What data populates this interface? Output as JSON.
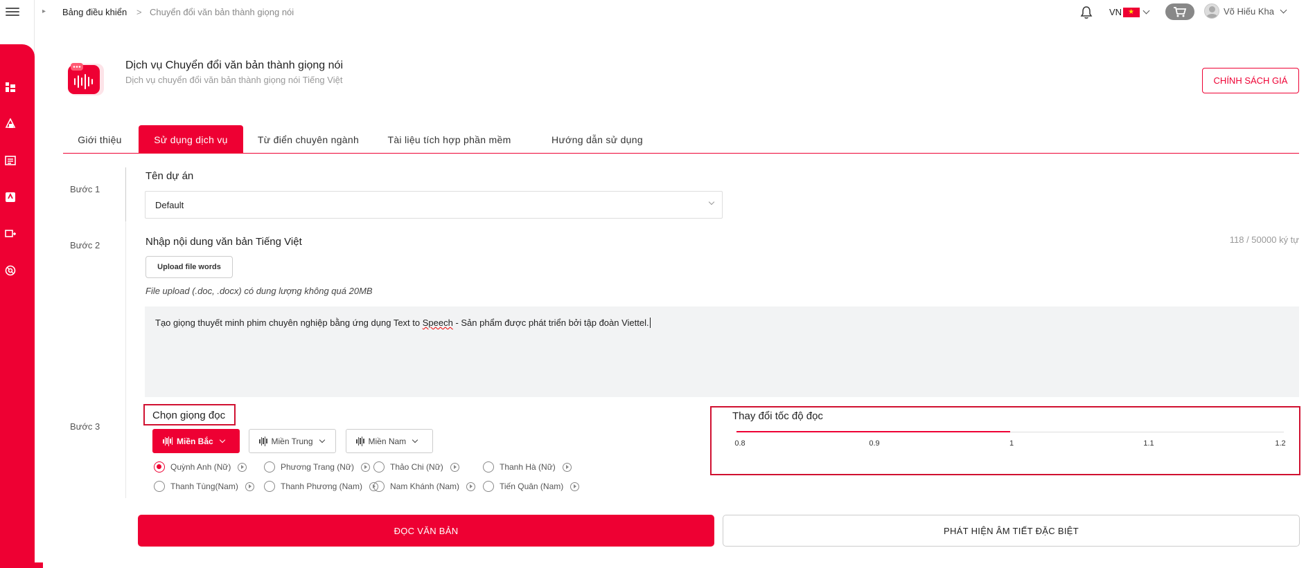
{
  "breadcrumb": {
    "home": "Bảng điều khiển",
    "separator": ">",
    "current": "Chuyển đổi văn bản thành giọng nói"
  },
  "topbar": {
    "language": "VN",
    "user_name": "Võ Hiếu Kha"
  },
  "service": {
    "title": "Dịch vụ Chuyển đổi văn bản thành giọng nói",
    "subtitle": "Dịch vụ chuyển đổi văn bản thành giọng nói Tiếng Việt",
    "price_button": "CHÍNH SÁCH GIÁ"
  },
  "tabs": [
    {
      "label": "Giới thiệu",
      "active": false
    },
    {
      "label": "Sử dụng dịch vụ",
      "active": true
    },
    {
      "label": "Từ điển chuyên ngành",
      "active": false
    },
    {
      "label": "Tài liệu tích hợp phần mềm",
      "active": false
    },
    {
      "label": "Hướng dẫn sử dụng",
      "active": false
    }
  ],
  "step1": {
    "step_label": "Bước 1",
    "field_label": "Tên dự án",
    "project_value": "Default"
  },
  "step2": {
    "step_label": "Bước 2",
    "field_label": "Nhập nội dung văn bản Tiếng Việt",
    "char_count": "118 / 50000 ký tự",
    "upload_button": "Upload file words",
    "upload_note": "File upload (.doc, .docx) có dung lượng không quá 20MB",
    "text_before": "Tạo giọng thuyết minh phim chuyên nghiệp bằng ứng dụng Text to ",
    "text_misspelled": "Speech",
    "text_after": " - Sản phẩm được phát triển bởi tập đoàn Viettel."
  },
  "step3": {
    "step_label": "Bước 3",
    "voice_label": "Chọn giọng đọc",
    "regions": [
      {
        "label": "Miền Bắc",
        "active": true
      },
      {
        "label": "Miền Trung",
        "active": false
      },
      {
        "label": "Miền Nam",
        "active": false
      }
    ],
    "voices": [
      {
        "label": "Quỳnh Anh (Nữ)",
        "selected": true
      },
      {
        "label": "Phương Trang (Nữ)",
        "selected": false
      },
      {
        "label": "Thảo Chi (Nữ)",
        "selected": false
      },
      {
        "label": "Thanh Hà (Nữ)",
        "selected": false
      },
      {
        "label": "Thanh Tùng(Nam)",
        "selected": false
      },
      {
        "label": "Thanh Phương (Nam)",
        "selected": false
      },
      {
        "label": "Nam Khánh (Nam)",
        "selected": false
      },
      {
        "label": "Tiến Quân (Nam)",
        "selected": false
      }
    ],
    "speed": {
      "title": "Thay đổi tốc độ đọc",
      "ticks": [
        "0.8",
        "0.9",
        "1",
        "1.1",
        "1.2"
      ],
      "min": 0.8,
      "max": 1.2,
      "value": 1
    }
  },
  "actions": {
    "read_button": "ĐỌC VĂN BẢN",
    "detect_button": "PHÁT HIỆN ÂM TIẾT ĐẶC BIỆT"
  },
  "colors": {
    "accent": "#ee0033",
    "highlight_border": "#d01030"
  },
  "icons": {
    "sidebar": [
      "dashboard-icon",
      "shapes-icon",
      "document-icon",
      "service-icon",
      "device-icon",
      "support-icon"
    ]
  }
}
